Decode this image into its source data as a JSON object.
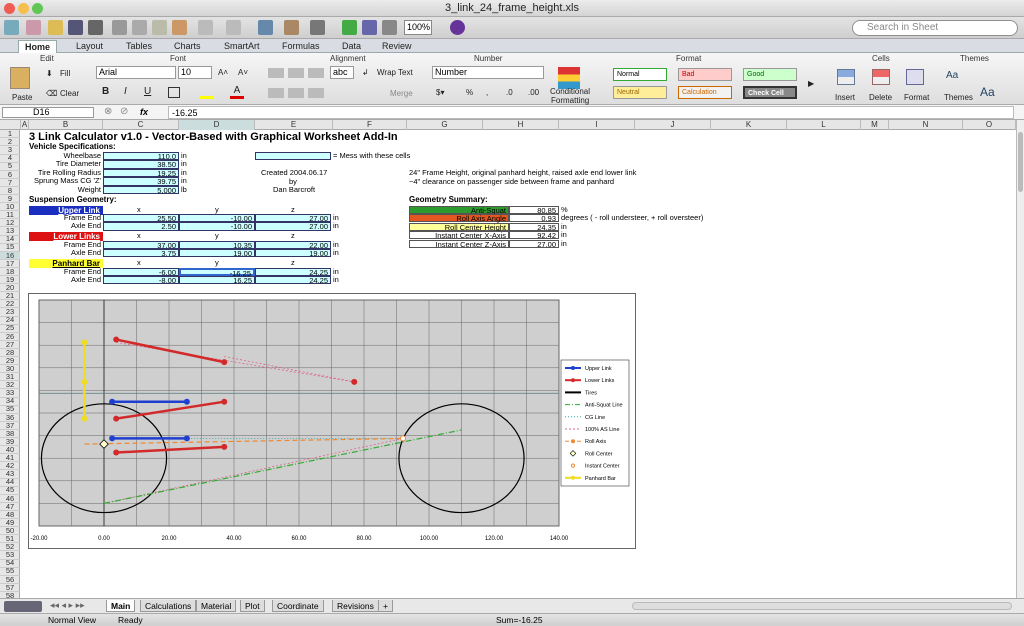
{
  "window": {
    "title": "3_link_24_frame_height.xls"
  },
  "toolbar": {
    "zoom": "100%",
    "search_placeholder": "Search in Sheet"
  },
  "ribbon": {
    "tabs": [
      "Home",
      "Layout",
      "Tables",
      "Charts",
      "SmartArt",
      "Formulas",
      "Data",
      "Review"
    ],
    "groups": {
      "edit": "Edit",
      "font": "Font",
      "alignment": "Alignment",
      "number": "Number",
      "format": "Format",
      "cells": "Cells",
      "themes": "Themes"
    },
    "paste": "Paste",
    "fill": "Fill",
    "clear": "Clear",
    "font_name": "Arial",
    "font_size": "10",
    "bold": "B",
    "italic": "I",
    "underline": "U",
    "wrap_text": "Wrap Text",
    "merge": "Merge",
    "abc": "abc",
    "number_format": "Number",
    "cond_format_1": "Conditional",
    "cond_format_2": "Formatting",
    "styles": {
      "normal": "Normal",
      "bad": "Bad",
      "good": "Good",
      "neutral": "Neutral",
      "calculation": "Calculation",
      "check_cell": "Check Cell"
    },
    "insert": "Insert",
    "delete": "Delete",
    "format": "Format",
    "themes_btn": "Themes",
    "aa": "Aa"
  },
  "formula_bar": {
    "cell_ref": "D16",
    "fx": "fx",
    "value": "-16.25"
  },
  "columns": [
    "A",
    "B",
    "C",
    "D",
    "E",
    "F",
    "G",
    "H",
    "I",
    "J",
    "K",
    "L",
    "M",
    "N",
    "O"
  ],
  "rows": [
    "1",
    "2",
    "3",
    "4",
    "5",
    "6",
    "7",
    "8",
    "9",
    "10",
    "11",
    "12",
    "13",
    "14",
    "15",
    "16",
    "17",
    "18",
    "19",
    "20",
    "21",
    "22",
    "23",
    "24",
    "25",
    "26",
    "27",
    "28",
    "29",
    "30",
    "31",
    "32",
    "33",
    "34",
    "35",
    "36",
    "37",
    "38",
    "39",
    "40",
    "41",
    "42",
    "43",
    "44",
    "45",
    "46",
    "47",
    "48",
    "49",
    "50",
    "51",
    "52",
    "53",
    "54",
    "55",
    "56",
    "57",
    "58",
    "59"
  ],
  "sheet": {
    "title": "3 Link Calculator v1.0  -  Vector-Based with Graphical Worksheet Add-In",
    "vehicle_specs": "Vehicle Specifications:",
    "specs": [
      {
        "label": "Wheelbase",
        "value": "110.0",
        "unit": "in"
      },
      {
        "label": "Tire Diameter",
        "value": "38.50",
        "unit": "in"
      },
      {
        "label": "Tire Rolling Radius",
        "value": "19.25",
        "unit": "in"
      },
      {
        "label": "Sprung Mass CG 'Z'",
        "value": "39.75",
        "unit": "in"
      },
      {
        "label": "Weight",
        "value": "5,000",
        "unit": "lb"
      }
    ],
    "mess_note": "= Mess with these cells",
    "created": "Created 2004.06.17",
    "by": "by",
    "author": "Dan Barcroft",
    "note1": "24\" Frame Height, original panhard height, raised axle end lower link",
    "note2": "~4\" clearance on passenger side between frame and panhard",
    "susp_geometry": "Suspension Geometry:",
    "x": "x",
    "y": "y",
    "z": "z",
    "in": "in",
    "upper_link": "Upper Link",
    "lower_links": "Lower Links",
    "panhard_bar": "Panhard Bar",
    "frame_end": "Frame End",
    "axle_end": "Axle End",
    "upper": {
      "frame": [
        "25.50",
        "-10.00",
        "27.00"
      ],
      "axle": [
        "2.50",
        "-10.00",
        "27.00"
      ]
    },
    "lower": {
      "frame": [
        "37.00",
        "10.35",
        "22.00"
      ],
      "axle": [
        "3.75",
        "19.00",
        "19.00"
      ]
    },
    "panhard": {
      "frame": [
        "-6.00",
        "-16.25",
        "24.25"
      ],
      "axle": [
        "-8.00",
        "16.25",
        "24.25"
      ]
    },
    "geometry_summary": "Geometry Summary:",
    "summary": [
      {
        "label": "Anti-Squat",
        "value": "80.85",
        "unit": "%",
        "color": "#2e9a2e"
      },
      {
        "label": "Roll Axis Angle",
        "value": "0.93",
        "unit": "degrees ( - roll understeer, + roll oversteer)",
        "color": "#e2561f"
      },
      {
        "label": "Roll Center Height",
        "value": "24.35",
        "unit": "in",
        "color": "#ffff99"
      },
      {
        "label": "Instant Center X-Axis",
        "value": "92.42",
        "unit": "in",
        "color": ""
      },
      {
        "label": "Instant Center Z-Axis",
        "value": "27.00",
        "unit": "in",
        "color": ""
      }
    ]
  },
  "chart_data": {
    "type": "scatter",
    "xlim": [
      -20,
      140
    ],
    "x_ticks": [
      "-20.00",
      "0.00",
      "20.00",
      "40.00",
      "60.00",
      "80.00",
      "100.00",
      "120.00",
      "140.00"
    ],
    "legend": [
      "Upper Link",
      "Lower Links",
      "Tires",
      "Anti-Squat Line",
      "CG Line",
      "100% AS Line",
      "Roll Axis",
      "Roll Center",
      "Instant Center",
      "Panhard Bar"
    ],
    "legend_position": "right",
    "colors": {
      "upper": "#1f3fd1",
      "lower": "#d22a2a",
      "tires": "#000000",
      "anti_squat": "#33aa33",
      "cg": "#33aaaa",
      "as100": "#dd6688",
      "roll_axis": "#ee8833",
      "panhard": "#eedd22"
    }
  },
  "sheet_tabs": [
    "Main",
    "Calculations",
    "Material",
    "Plot",
    "Coordinate",
    "Revisions",
    "+"
  ],
  "status": {
    "view": "Normal View",
    "ready": "Ready",
    "sum": "Sum=-16.25"
  }
}
